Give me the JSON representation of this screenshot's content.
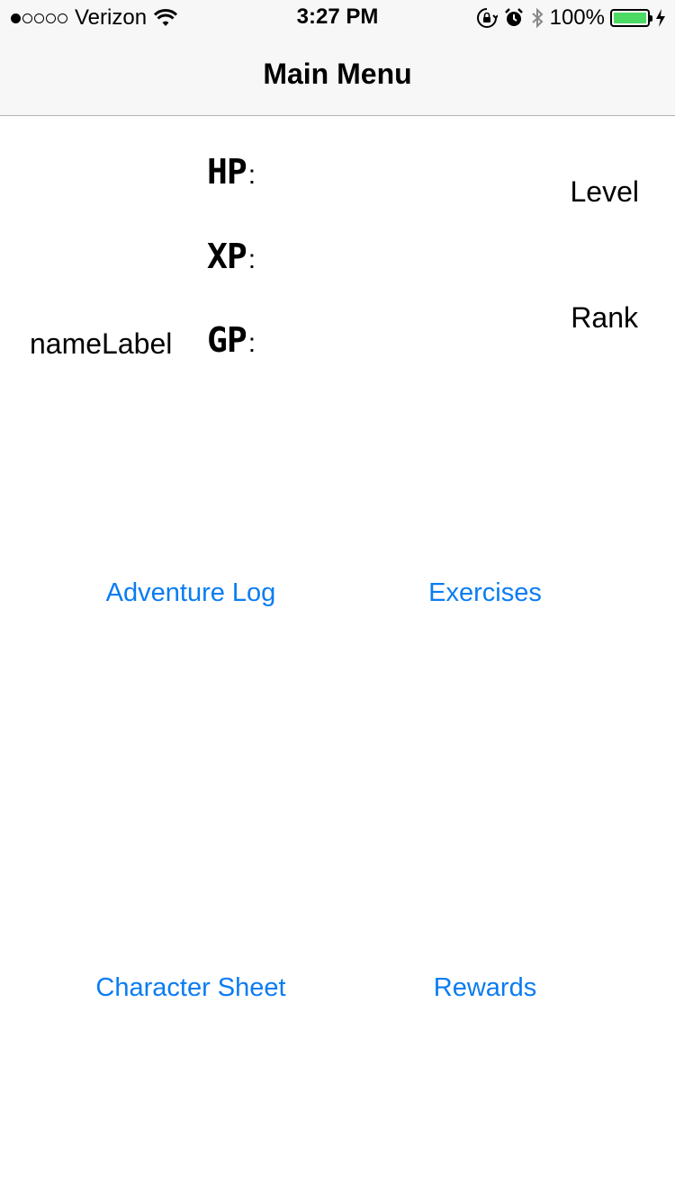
{
  "status_bar": {
    "carrier": "Verizon",
    "signal_bars_filled": 1,
    "signal_bars_total": 5,
    "time": "3:27 PM",
    "battery_percent": "100%",
    "battery_color": "#4cd964",
    "icons": [
      "wifi-icon",
      "orientation-lock-icon",
      "alarm-icon",
      "bluetooth-icon",
      "battery-icon",
      "charging-bolt-icon"
    ]
  },
  "nav": {
    "title": "Main Menu"
  },
  "stats": {
    "hp_label": "HP",
    "xp_label": "XP",
    "gp_label": "GP",
    "colon": ":",
    "name_label": "nameLabel",
    "level_label": "Level",
    "rank_label": "Rank"
  },
  "menu": {
    "adventure_log": "Adventure Log",
    "exercises": "Exercises",
    "character_sheet": "Character Sheet",
    "rewards": "Rewards",
    "link_color": "#0a7cf2"
  }
}
